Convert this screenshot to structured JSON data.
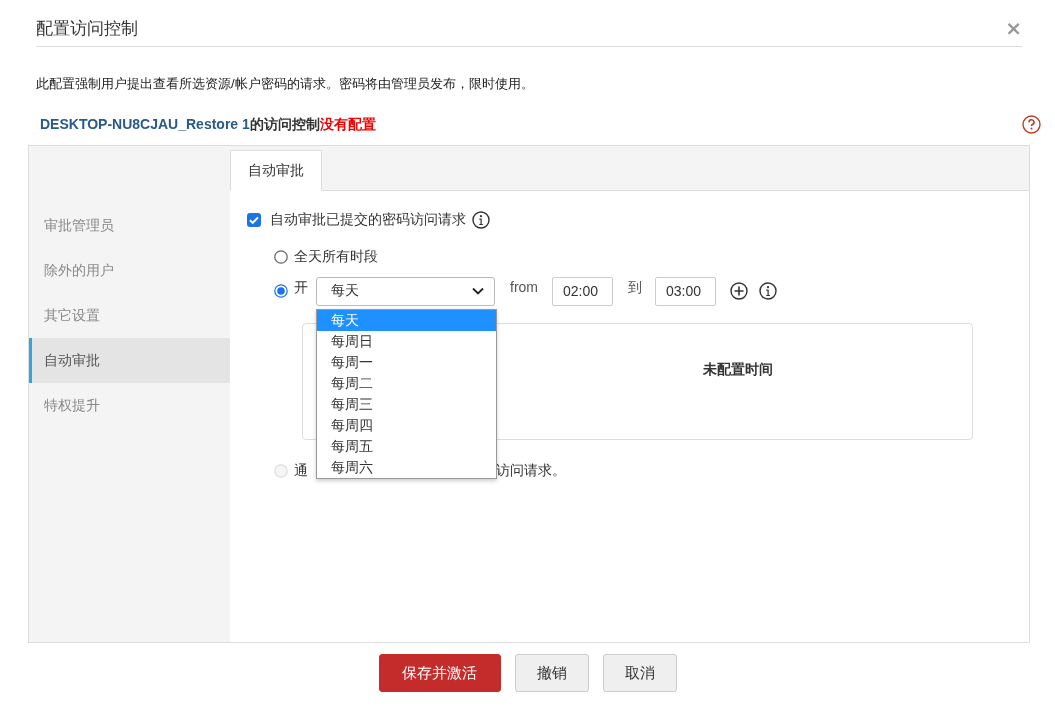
{
  "dialog": {
    "title": "配置访问控制",
    "close_label": "×",
    "description": "此配置强制用户提出查看所选资源/帐户密码的请求。密码将由管理员发布，限时使用。",
    "status": {
      "resource": "DESKTOP-NU8CJAU_Restore 1",
      "middle": "的访问控制",
      "state": "没有配置"
    }
  },
  "sidebar": {
    "items": [
      {
        "label": "审批管理员",
        "selected": false
      },
      {
        "label": "除外的用户",
        "selected": false
      },
      {
        "label": "其它设置",
        "selected": false
      },
      {
        "label": "自动审批",
        "selected": true
      },
      {
        "label": "特权提升",
        "selected": false
      }
    ]
  },
  "tabs": [
    {
      "label": "自动审批",
      "selected": true
    }
  ],
  "auto_approve": {
    "label": "自动审批已提交的密码访问请求",
    "checked": true
  },
  "options": [
    {
      "kind": "all_day",
      "label": "全天所有时段",
      "selected": false,
      "disabled": false
    },
    {
      "kind": "schedule",
      "label": "开",
      "selected": true,
      "disabled": false
    },
    {
      "kind": "ticket",
      "label_parts": [
        "通",
        "访问请求。"
      ],
      "selected": false,
      "disabled": true
    }
  ],
  "schedule": {
    "period": "每天",
    "from_label": "from",
    "from": "02:00",
    "to_label": "到",
    "to": "03:00",
    "empty_text": "未配置时间"
  },
  "period_dropdown": {
    "options": [
      {
        "label": "每天",
        "selected": true
      },
      {
        "label": "每周日",
        "selected": false
      },
      {
        "label": "每周一",
        "selected": false
      },
      {
        "label": "每周二",
        "selected": false
      },
      {
        "label": "每周三",
        "selected": false
      },
      {
        "label": "每周四",
        "selected": false
      },
      {
        "label": "每周五",
        "selected": false
      },
      {
        "label": "每周六",
        "selected": false
      }
    ]
  },
  "buttons": [
    {
      "label": "保存并激活",
      "kind": "primary"
    },
    {
      "label": "撤销",
      "kind": "secondary"
    },
    {
      "label": "取消",
      "kind": "secondary"
    }
  ]
}
